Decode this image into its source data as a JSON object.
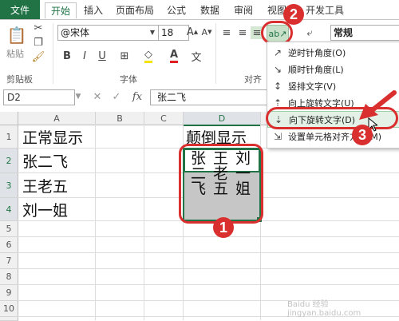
{
  "tabs": [
    {
      "label": "文件"
    },
    {
      "label": "开始"
    },
    {
      "label": "插入"
    },
    {
      "label": "页面布局"
    },
    {
      "label": "公式"
    },
    {
      "label": "数据"
    },
    {
      "label": "审阅"
    },
    {
      "label": "视图"
    },
    {
      "label": "开发工具"
    }
  ],
  "ribbon": {
    "paste_label": "粘贴",
    "clipboard_group": "剪贴板",
    "font_name": "@宋体",
    "font_size": "18",
    "font_group": "字体",
    "bold": "B",
    "italic": "I",
    "underline": "U",
    "align_group_partial": "对齐",
    "number_format": "常规",
    "orientation_icon": "ab↗"
  },
  "formula_bar": {
    "name_box": "D2",
    "fx": "fx",
    "cancel": "✕",
    "enter": "✓",
    "content": "张二飞"
  },
  "columns": [
    "A",
    "B",
    "C",
    "D"
  ],
  "rows": [
    "1",
    "2",
    "3",
    "4",
    "5",
    "6",
    "7",
    "8",
    "9",
    "10",
    "11"
  ],
  "cells": {
    "A1": "正常显示",
    "A2": "张二飞",
    "A3": "王老五",
    "A4": "刘一姐",
    "D1": "颠倒显示",
    "D2": "张二飞",
    "D3": "王老五",
    "D4": "刘一姐"
  },
  "orientation_menu": [
    {
      "icon": "counterclockwise-icon",
      "label": "逆时针角度(O)"
    },
    {
      "icon": "clockwise-icon",
      "label": "顺时针角度(L)"
    },
    {
      "icon": "vertical-text-icon",
      "label": "竖排文字(V)"
    },
    {
      "icon": "rotate-up-icon",
      "label": "向上旋转文字(U)"
    },
    {
      "icon": "rotate-down-icon",
      "label": "向下旋转文字(D)"
    },
    {
      "icon": "format-alignment-icon",
      "label": "设置单元格对齐方式(M)"
    }
  ],
  "callouts": {
    "one": "1",
    "two": "2",
    "three": "3"
  },
  "watermark": "Baidu 经验 jingyan.baidu.com",
  "colors": {
    "excel_green": "#217346",
    "highlight_red": "#d9302f",
    "menu_hover": "#e3f1e6",
    "selection": "#c6c6c6"
  }
}
